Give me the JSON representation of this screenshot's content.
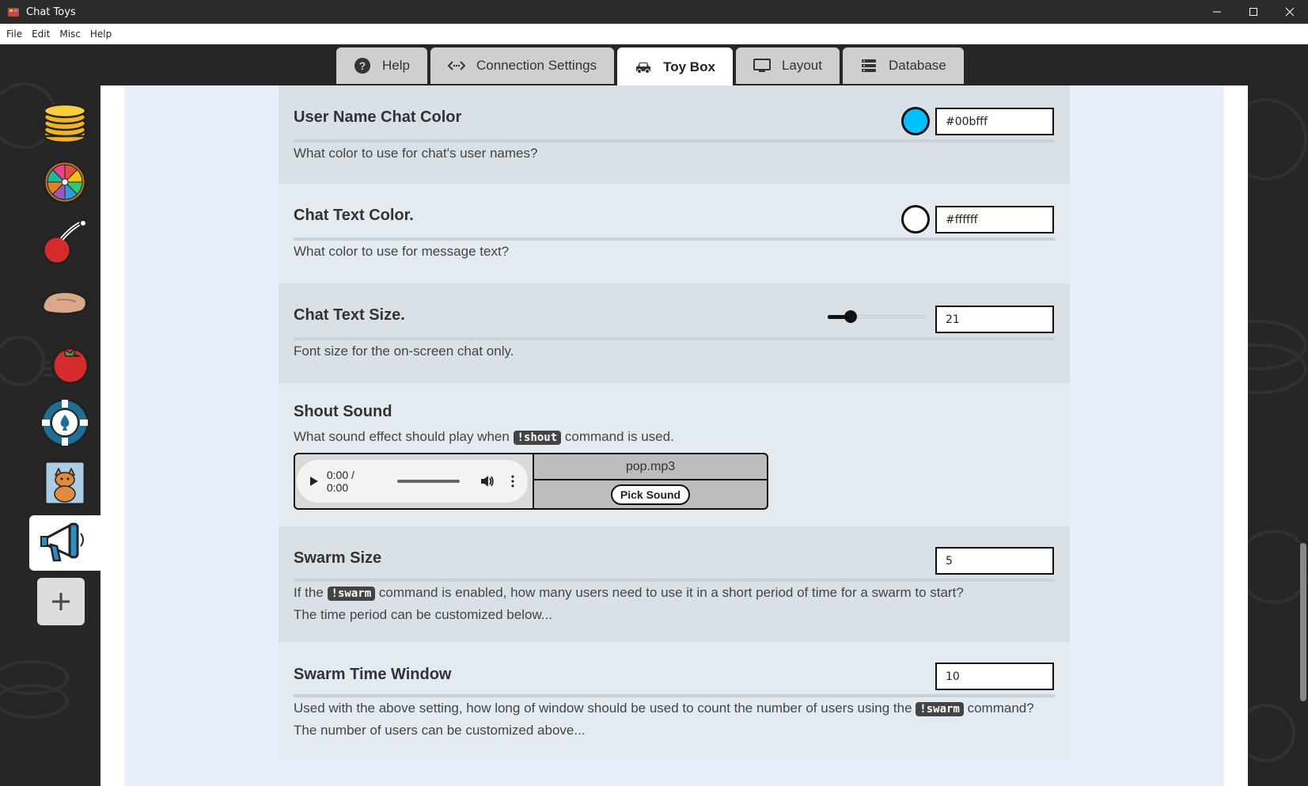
{
  "window": {
    "title": "Chat Toys",
    "controls": {
      "minimize": "—",
      "maximize": "☐",
      "close": "✕"
    }
  },
  "menu": {
    "items": [
      "File",
      "Edit",
      "Misc",
      "Help"
    ]
  },
  "tabs": [
    {
      "label": "Help",
      "icon": "question-circle-icon"
    },
    {
      "label": "Connection Settings",
      "icon": "code-arrows-icon"
    },
    {
      "label": "Toy Box",
      "icon": "car-icon",
      "active": true
    },
    {
      "label": "Layout",
      "icon": "monitor-icon"
    },
    {
      "label": "Database",
      "icon": "database-icon"
    }
  ],
  "sidebar": {
    "items": [
      {
        "name": "coins",
        "icon": "coin-stack-icon"
      },
      {
        "name": "wheel",
        "icon": "prize-wheel-icon"
      },
      {
        "name": "cherry",
        "icon": "cherry-bomb-icon"
      },
      {
        "name": "hand",
        "icon": "hand-icon"
      },
      {
        "name": "tomato",
        "icon": "tomato-icon"
      },
      {
        "name": "poker-chip",
        "icon": "poker-chip-icon"
      },
      {
        "name": "cat",
        "icon": "cat-card-icon"
      },
      {
        "name": "megaphone",
        "icon": "megaphone-icon",
        "active": true
      }
    ],
    "add_label": "+"
  },
  "settings": {
    "user_name_color": {
      "title": "User Name Chat Color",
      "description": "What color to use for chat's user names?",
      "value": "#00bfff",
      "swatch": "#00bfff"
    },
    "chat_text_color": {
      "title": "Chat Text Color.",
      "description": "What color to use for message text?",
      "value": "#ffffff",
      "swatch": "#ffffff"
    },
    "chat_text_size": {
      "title": "Chat Text Size.",
      "description": "Font size for the on-screen chat only.",
      "value": "21",
      "slider_fraction": 0.23
    },
    "shout_sound": {
      "title": "Shout Sound",
      "description_before": "What sound effect should play when",
      "command": "!shout",
      "description_after": "command is used.",
      "time": "0:00 / 0:00",
      "file": "pop.mp3",
      "pick_label": "Pick Sound"
    },
    "swarm_size": {
      "title": "Swarm Size",
      "value": "5",
      "desc_before": "If the",
      "command": "!swarm",
      "desc_after": "command is enabled, how many users need to use it in a short period of time for a swarm to start?",
      "desc_line2": "The time period can be customized below..."
    },
    "swarm_time": {
      "title": "Swarm Time Window",
      "value": "10",
      "desc_before": "Used with the above setting, how long of window should be used to count the number of users using the",
      "command": "!swarm",
      "desc_after": "command?",
      "desc_line2": "The number of users can be customized above..."
    }
  }
}
